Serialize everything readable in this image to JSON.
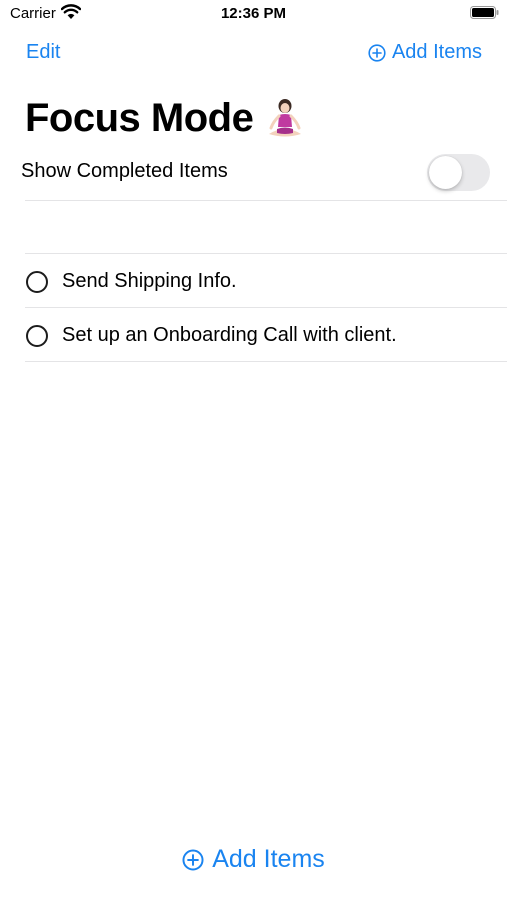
{
  "status_bar": {
    "carrier": "Carrier",
    "time": "12:36 PM"
  },
  "nav": {
    "edit_label": "Edit",
    "add_label": "Add Items"
  },
  "page": {
    "title": "Focus Mode",
    "title_icon": "person-in-lotus-position-icon"
  },
  "settings": {
    "show_completed_label": "Show Completed Items",
    "show_completed_on": false
  },
  "items": [
    {
      "label": "Send Shipping Info.",
      "completed": false
    },
    {
      "label": "Set up an Onboarding Call with client.",
      "completed": false
    }
  ],
  "bottom": {
    "add_label": "Add Items"
  },
  "colors": {
    "accent": "#1a84f0",
    "toggle_off": "#e9e9eb",
    "separator": "#e4e4e6"
  }
}
